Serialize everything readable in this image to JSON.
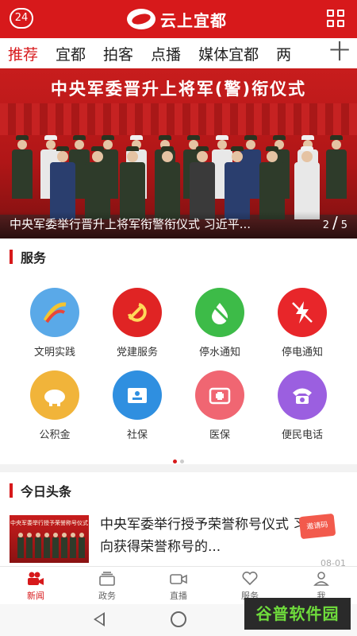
{
  "header": {
    "badge": "24",
    "app_title": "云上宜都"
  },
  "tabs": [
    {
      "label": "推荐",
      "active": true
    },
    {
      "label": "宜都"
    },
    {
      "label": "拍客"
    },
    {
      "label": "点播"
    },
    {
      "label": "媒体宜都"
    },
    {
      "label": "两"
    }
  ],
  "tab_add_symbol": "十",
  "banner": {
    "image_title": "中央军委晋升上将军(警)衔仪式",
    "caption": "中央军委举行晋升上将军衔警衔仪式 习近平...",
    "current": "2",
    "total": "5"
  },
  "services": {
    "title": "服务",
    "items": [
      {
        "label": "文明实践",
        "icon": "civilization-practice-icon",
        "color": "#5aa9e8"
      },
      {
        "label": "党建服务",
        "icon": "party-emblem-icon",
        "color": "#e02424"
      },
      {
        "label": "停水通知",
        "icon": "water-drop-off-icon",
        "color": "#3dbb48"
      },
      {
        "label": "停电通知",
        "icon": "power-off-icon",
        "color": "#e8262a"
      },
      {
        "label": "公积金",
        "icon": "piggy-bank-icon",
        "color": "#f1b43a"
      },
      {
        "label": "社保",
        "icon": "social-security-card-icon",
        "color": "#2f8fe0"
      },
      {
        "label": "医保",
        "icon": "medical-kit-icon",
        "color": "#f06672"
      },
      {
        "label": "便民电话",
        "icon": "telephone-icon",
        "color": "#9b5fe0"
      }
    ],
    "page_dots": 2,
    "active_dot": 0
  },
  "headlines": {
    "title": "今日头条",
    "items": [
      {
        "thumb_title": "中央军委举行授予荣誉称号仪式",
        "title": "中央军委举行授予荣誉称号仪式 习近平向获得荣誉称号的...",
        "time": "08-01"
      }
    ],
    "coupon_label": "邀请码"
  },
  "bottom_nav": [
    {
      "label": "新闻",
      "icon": "video-camera-icon",
      "active": true
    },
    {
      "label": "政务",
      "icon": "layers-icon"
    },
    {
      "label": "直播",
      "icon": "live-camera-icon"
    },
    {
      "label": "服务",
      "icon": "handshake-heart-icon"
    },
    {
      "label": "我",
      "icon": "person-icon"
    }
  ],
  "watermark": "谷普软件园",
  "colors": {
    "brand_red": "#d7191b",
    "text": "#222222",
    "muted": "#666666"
  }
}
